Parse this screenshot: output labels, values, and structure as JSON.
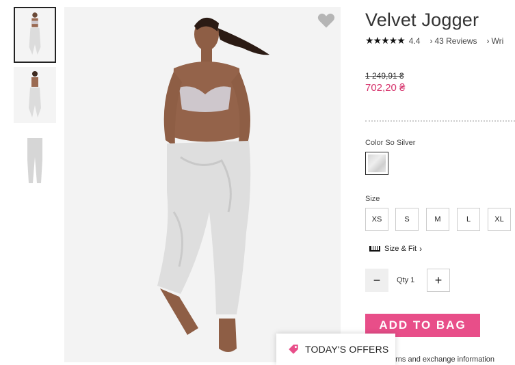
{
  "gallery": {
    "thumbnails": [
      {
        "name": "model-front",
        "active": true
      },
      {
        "name": "model-back",
        "active": false
      },
      {
        "name": "product-flat",
        "active": false
      }
    ]
  },
  "product": {
    "title": "Velvet Jogger",
    "rating": {
      "stars": "★★★★★",
      "value": "4.4",
      "reviews_label": "43 Reviews",
      "write_label": "Wri"
    },
    "price_old": "1 249,91 ₴",
    "price_new": "702,20 ₴",
    "color_label": "Color So Silver",
    "size_label": "Size",
    "sizes": [
      "XS",
      "S",
      "M",
      "L",
      "XL"
    ],
    "size_fit_label": "Size & Fit",
    "qty_label": "Qty 1",
    "add_to_bag_label": "ADD TO BAG",
    "returns_text": "urns and exchange information"
  },
  "offers": {
    "label": "TODAY'S OFFERS"
  },
  "colors": {
    "accent": "#e84e89",
    "price": "#d6336c"
  },
  "icons": {
    "wishlist": "heart-icon",
    "offers": "tag-icon",
    "fit": "ruler-icon"
  }
}
